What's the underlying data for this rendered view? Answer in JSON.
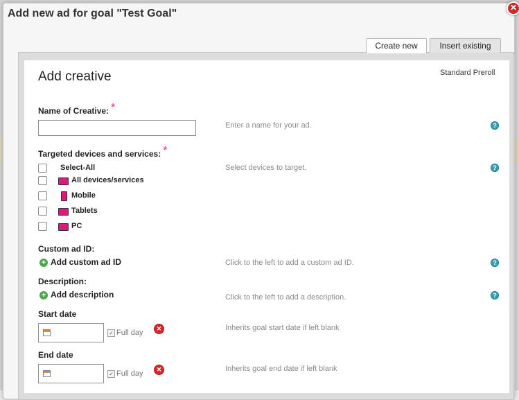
{
  "modal": {
    "title": "Add new ad for goal \"Test Goal\"",
    "close_glyph": "✕"
  },
  "tabs": [
    {
      "label": "Create new",
      "active": true
    },
    {
      "label": "Insert existing",
      "active": false
    }
  ],
  "form": {
    "heading": "Add creative",
    "ad_type": "Standard Preroll",
    "required_mark": "*",
    "help_glyph": "?",
    "name": {
      "label": "Name of Creative:",
      "value": "",
      "hint": "Enter a name for your ad."
    },
    "devices": {
      "label": "Targeted devices and services:",
      "hint": "Select devices to target.",
      "options": [
        {
          "label": "Select-All",
          "icon": "",
          "checked": false
        },
        {
          "label": "All devices/services",
          "icon": "all-devices-icon",
          "checked": false
        },
        {
          "label": "Mobile",
          "icon": "mobile-icon",
          "checked": false
        },
        {
          "label": "Tablets",
          "icon": "tablet-icon",
          "checked": false
        },
        {
          "label": "PC",
          "icon": "pc-icon",
          "checked": false
        }
      ]
    },
    "custom_id": {
      "label": "Custom ad ID:",
      "action": "Add custom ad ID",
      "hint": "Click to the left to add a custom ad ID."
    },
    "description": {
      "label": "Description:",
      "action": "Add description",
      "hint": "Click to the left to add a description."
    },
    "start_date": {
      "label": "Start date",
      "value": "",
      "full_day_label": "Full day",
      "full_day_checked": true,
      "hint": "Inherits goal start date if left blank"
    },
    "end_date": {
      "label": "End date",
      "value": "",
      "full_day_label": "Full day",
      "full_day_checked": true,
      "hint": "Inherits goal end date if left blank"
    }
  },
  "colors": {
    "required": "#e0187b",
    "help": "#3a9fb4",
    "add": "#4aa84a",
    "remove": "#d8262c"
  }
}
